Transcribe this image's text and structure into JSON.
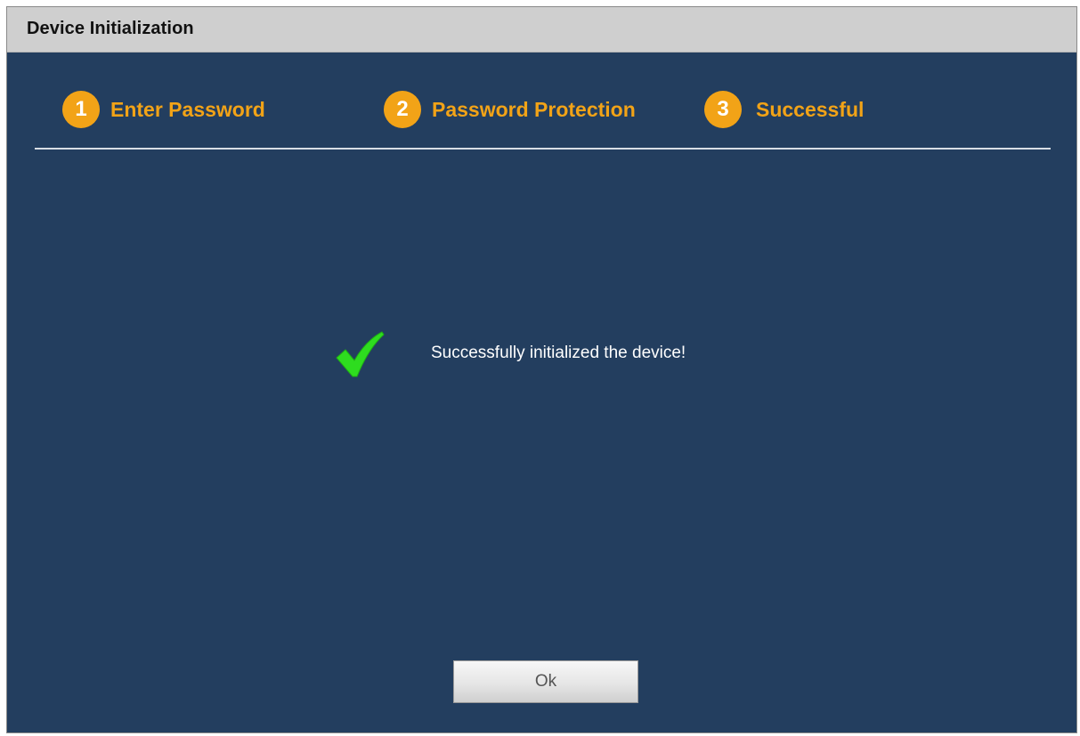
{
  "window": {
    "title": "Device Initialization"
  },
  "steps": [
    {
      "number": "1",
      "label": "Enter Password"
    },
    {
      "number": "2",
      "label": "Password Protection"
    },
    {
      "number": "3",
      "label": "Successful"
    }
  ],
  "main": {
    "status_icon": "checkmark-icon",
    "message": "Successfully initialized the device!"
  },
  "footer": {
    "ok_label": "Ok"
  },
  "colors": {
    "background": "#233e5f",
    "titlebar": "#cfcfcf",
    "accent": "#f2a317",
    "success": "#33dd22"
  }
}
